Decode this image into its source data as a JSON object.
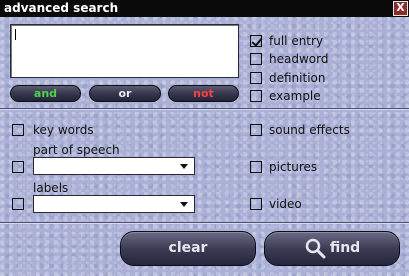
{
  "window": {
    "title": "advanced search",
    "close_label": "X"
  },
  "search": {
    "value": ""
  },
  "operators": {
    "and": "and",
    "or": "or",
    "not": "not"
  },
  "search_in": [
    {
      "label": "full entry",
      "checked": true
    },
    {
      "label": "headword",
      "checked": false
    },
    {
      "label": "definition",
      "checked": false
    },
    {
      "label": "example",
      "checked": false
    }
  ],
  "filters": {
    "key_words": {
      "label": "key words",
      "checked": false
    },
    "part_of_speech": {
      "label": "part of speech",
      "checked": false,
      "selected": ""
    },
    "labels": {
      "label": "labels",
      "checked": false,
      "selected": ""
    },
    "sound_effects": {
      "label": "sound effects",
      "checked": false
    },
    "pictures": {
      "label": "pictures",
      "checked": false
    },
    "video": {
      "label": "video",
      "checked": false
    }
  },
  "actions": {
    "clear": "clear",
    "find": "find"
  },
  "icons": {
    "close": "close-icon",
    "search": "magnifier-icon",
    "dropdown": "chevron-down-icon"
  }
}
